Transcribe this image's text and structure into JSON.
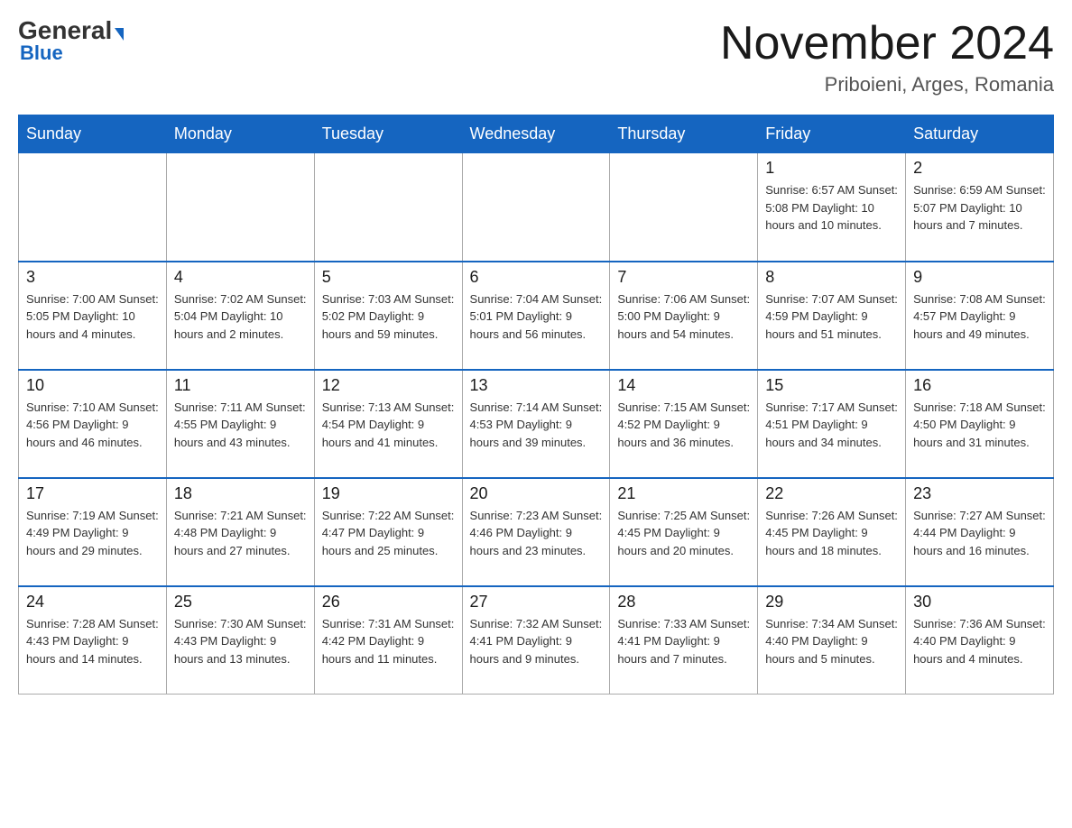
{
  "logo": {
    "general": "General",
    "arrow": "▶",
    "blue": "Blue"
  },
  "header": {
    "month": "November 2024",
    "location": "Priboieni, Arges, Romania"
  },
  "weekdays": [
    "Sunday",
    "Monday",
    "Tuesday",
    "Wednesday",
    "Thursday",
    "Friday",
    "Saturday"
  ],
  "weeks": [
    [
      {
        "day": "",
        "info": ""
      },
      {
        "day": "",
        "info": ""
      },
      {
        "day": "",
        "info": ""
      },
      {
        "day": "",
        "info": ""
      },
      {
        "day": "",
        "info": ""
      },
      {
        "day": "1",
        "info": "Sunrise: 6:57 AM\nSunset: 5:08 PM\nDaylight: 10 hours and 10 minutes."
      },
      {
        "day": "2",
        "info": "Sunrise: 6:59 AM\nSunset: 5:07 PM\nDaylight: 10 hours and 7 minutes."
      }
    ],
    [
      {
        "day": "3",
        "info": "Sunrise: 7:00 AM\nSunset: 5:05 PM\nDaylight: 10 hours and 4 minutes."
      },
      {
        "day": "4",
        "info": "Sunrise: 7:02 AM\nSunset: 5:04 PM\nDaylight: 10 hours and 2 minutes."
      },
      {
        "day": "5",
        "info": "Sunrise: 7:03 AM\nSunset: 5:02 PM\nDaylight: 9 hours and 59 minutes."
      },
      {
        "day": "6",
        "info": "Sunrise: 7:04 AM\nSunset: 5:01 PM\nDaylight: 9 hours and 56 minutes."
      },
      {
        "day": "7",
        "info": "Sunrise: 7:06 AM\nSunset: 5:00 PM\nDaylight: 9 hours and 54 minutes."
      },
      {
        "day": "8",
        "info": "Sunrise: 7:07 AM\nSunset: 4:59 PM\nDaylight: 9 hours and 51 minutes."
      },
      {
        "day": "9",
        "info": "Sunrise: 7:08 AM\nSunset: 4:57 PM\nDaylight: 9 hours and 49 minutes."
      }
    ],
    [
      {
        "day": "10",
        "info": "Sunrise: 7:10 AM\nSunset: 4:56 PM\nDaylight: 9 hours and 46 minutes."
      },
      {
        "day": "11",
        "info": "Sunrise: 7:11 AM\nSunset: 4:55 PM\nDaylight: 9 hours and 43 minutes."
      },
      {
        "day": "12",
        "info": "Sunrise: 7:13 AM\nSunset: 4:54 PM\nDaylight: 9 hours and 41 minutes."
      },
      {
        "day": "13",
        "info": "Sunrise: 7:14 AM\nSunset: 4:53 PM\nDaylight: 9 hours and 39 minutes."
      },
      {
        "day": "14",
        "info": "Sunrise: 7:15 AM\nSunset: 4:52 PM\nDaylight: 9 hours and 36 minutes."
      },
      {
        "day": "15",
        "info": "Sunrise: 7:17 AM\nSunset: 4:51 PM\nDaylight: 9 hours and 34 minutes."
      },
      {
        "day": "16",
        "info": "Sunrise: 7:18 AM\nSunset: 4:50 PM\nDaylight: 9 hours and 31 minutes."
      }
    ],
    [
      {
        "day": "17",
        "info": "Sunrise: 7:19 AM\nSunset: 4:49 PM\nDaylight: 9 hours and 29 minutes."
      },
      {
        "day": "18",
        "info": "Sunrise: 7:21 AM\nSunset: 4:48 PM\nDaylight: 9 hours and 27 minutes."
      },
      {
        "day": "19",
        "info": "Sunrise: 7:22 AM\nSunset: 4:47 PM\nDaylight: 9 hours and 25 minutes."
      },
      {
        "day": "20",
        "info": "Sunrise: 7:23 AM\nSunset: 4:46 PM\nDaylight: 9 hours and 23 minutes."
      },
      {
        "day": "21",
        "info": "Sunrise: 7:25 AM\nSunset: 4:45 PM\nDaylight: 9 hours and 20 minutes."
      },
      {
        "day": "22",
        "info": "Sunrise: 7:26 AM\nSunset: 4:45 PM\nDaylight: 9 hours and 18 minutes."
      },
      {
        "day": "23",
        "info": "Sunrise: 7:27 AM\nSunset: 4:44 PM\nDaylight: 9 hours and 16 minutes."
      }
    ],
    [
      {
        "day": "24",
        "info": "Sunrise: 7:28 AM\nSunset: 4:43 PM\nDaylight: 9 hours and 14 minutes."
      },
      {
        "day": "25",
        "info": "Sunrise: 7:30 AM\nSunset: 4:43 PM\nDaylight: 9 hours and 13 minutes."
      },
      {
        "day": "26",
        "info": "Sunrise: 7:31 AM\nSunset: 4:42 PM\nDaylight: 9 hours and 11 minutes."
      },
      {
        "day": "27",
        "info": "Sunrise: 7:32 AM\nSunset: 4:41 PM\nDaylight: 9 hours and 9 minutes."
      },
      {
        "day": "28",
        "info": "Sunrise: 7:33 AM\nSunset: 4:41 PM\nDaylight: 9 hours and 7 minutes."
      },
      {
        "day": "29",
        "info": "Sunrise: 7:34 AM\nSunset: 4:40 PM\nDaylight: 9 hours and 5 minutes."
      },
      {
        "day": "30",
        "info": "Sunrise: 7:36 AM\nSunset: 4:40 PM\nDaylight: 9 hours and 4 minutes."
      }
    ]
  ]
}
